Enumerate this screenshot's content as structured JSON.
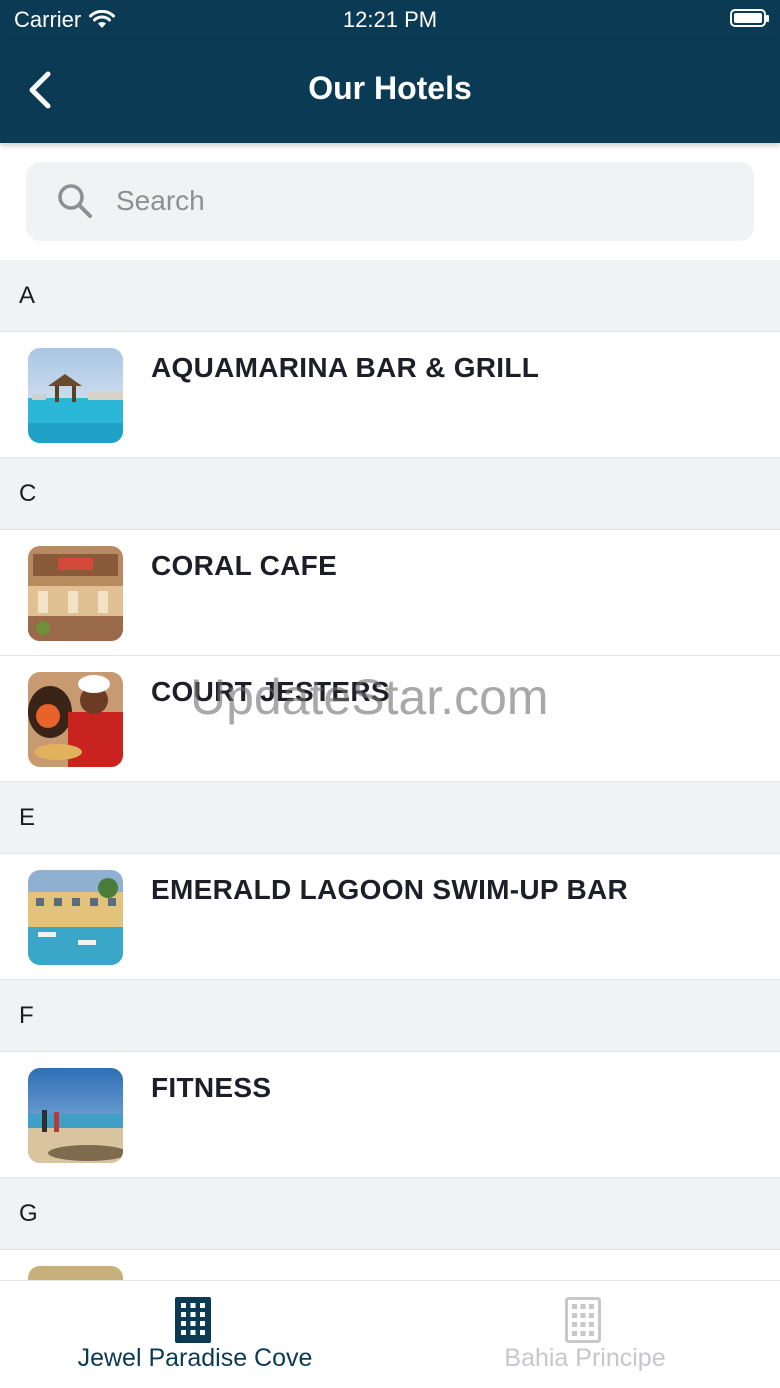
{
  "status_bar": {
    "carrier": "Carrier",
    "time": "12:21 PM"
  },
  "nav": {
    "title": "Our Hotels"
  },
  "search": {
    "placeholder": "Search"
  },
  "sections": [
    {
      "letter": "A",
      "items": [
        {
          "title": "AQUAMARINA BAR & GRILL",
          "image": "pool-with-palapa"
        }
      ]
    },
    {
      "letter": "C",
      "items": [
        {
          "title": "CORAL CAFE",
          "image": "cafe-interior"
        },
        {
          "title": "COURT JESTERS",
          "image": "pizza-chef"
        }
      ]
    },
    {
      "letter": "E",
      "items": [
        {
          "title": "EMERALD LAGOON SWIM-UP BAR",
          "image": "resort-pool"
        }
      ]
    },
    {
      "letter": "F",
      "items": [
        {
          "title": "FITNESS",
          "image": "beach-runners"
        }
      ]
    },
    {
      "letter": "G",
      "items": []
    }
  ],
  "tabs": [
    {
      "label": "Jewel Paradise Cove",
      "icon": "building-icon",
      "active": true,
      "color": "#0b3a55"
    },
    {
      "label": "Bahia Principe",
      "icon": "building-icon",
      "active": false,
      "color": "#c7c7cc"
    }
  ],
  "watermark": "UpdateStar.com",
  "colors": {
    "brand": "#0b3a55",
    "section_bg": "#f1f2f4"
  }
}
